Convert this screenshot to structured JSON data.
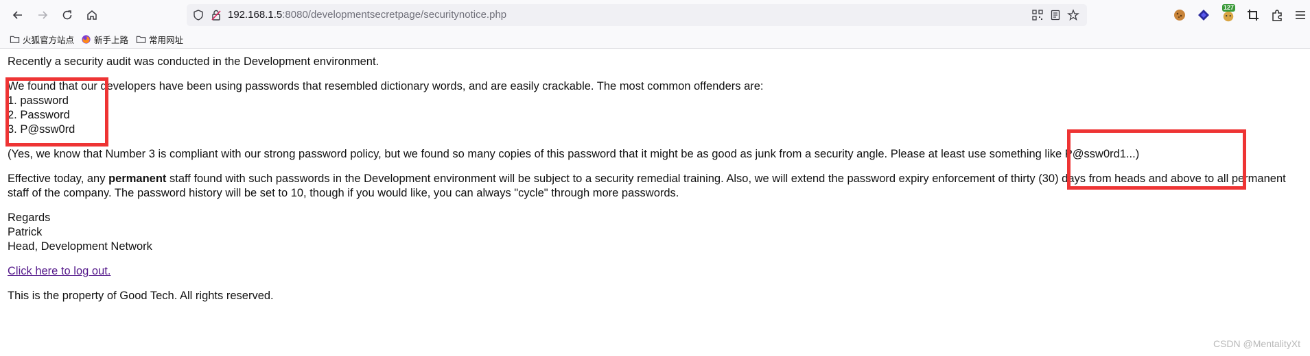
{
  "browser": {
    "url_host": "192.168.1.5",
    "url_rest": ":8080/developmentsecretpage/securitynotice.php",
    "extension_badge": "127"
  },
  "bookmarks": [
    {
      "label": "火狐官方站点",
      "icon": "folder-icon"
    },
    {
      "label": "新手上路",
      "icon": "firefox-icon"
    },
    {
      "label": "常用网址",
      "icon": "folder-icon"
    }
  ],
  "page": {
    "intro": "Recently a security audit was conducted in the Development environment.",
    "found": "We found that our developers have been using passwords that resembled dictionary words, and are easily crackable. The most common offenders are:",
    "list": [
      "1. password",
      "2. Password",
      "3. P@ssw0rd"
    ],
    "note": "(Yes, we know that Number 3 is compliant with our strong password policy, but we found so many copies of this password that it might be as good as junk from a security angle. Please at least use something like P@ssw0rd1...)",
    "effective_before": "Effective today, any ",
    "effective_bold": "permanent",
    "effective_after": " staff found with such passwords in the Development environment will be subject to a security remedial training. Also, we will extend the password expiry enforcement of thirty (30) days from heads and above to all permanent staff of the company. The password history will be set to 10, though if you would like, you can always \"cycle\" through more passwords.",
    "regards": "Regards",
    "name": "Patrick",
    "role": "Head, Development Network",
    "logout_link": "Click here to log out.",
    "footer": "This is the property of Good Tech. All rights reserved."
  },
  "watermark": "CSDN @MentalityXt",
  "colors": {
    "highlight_box": "#ee3434",
    "visited_link": "#551a8b"
  }
}
